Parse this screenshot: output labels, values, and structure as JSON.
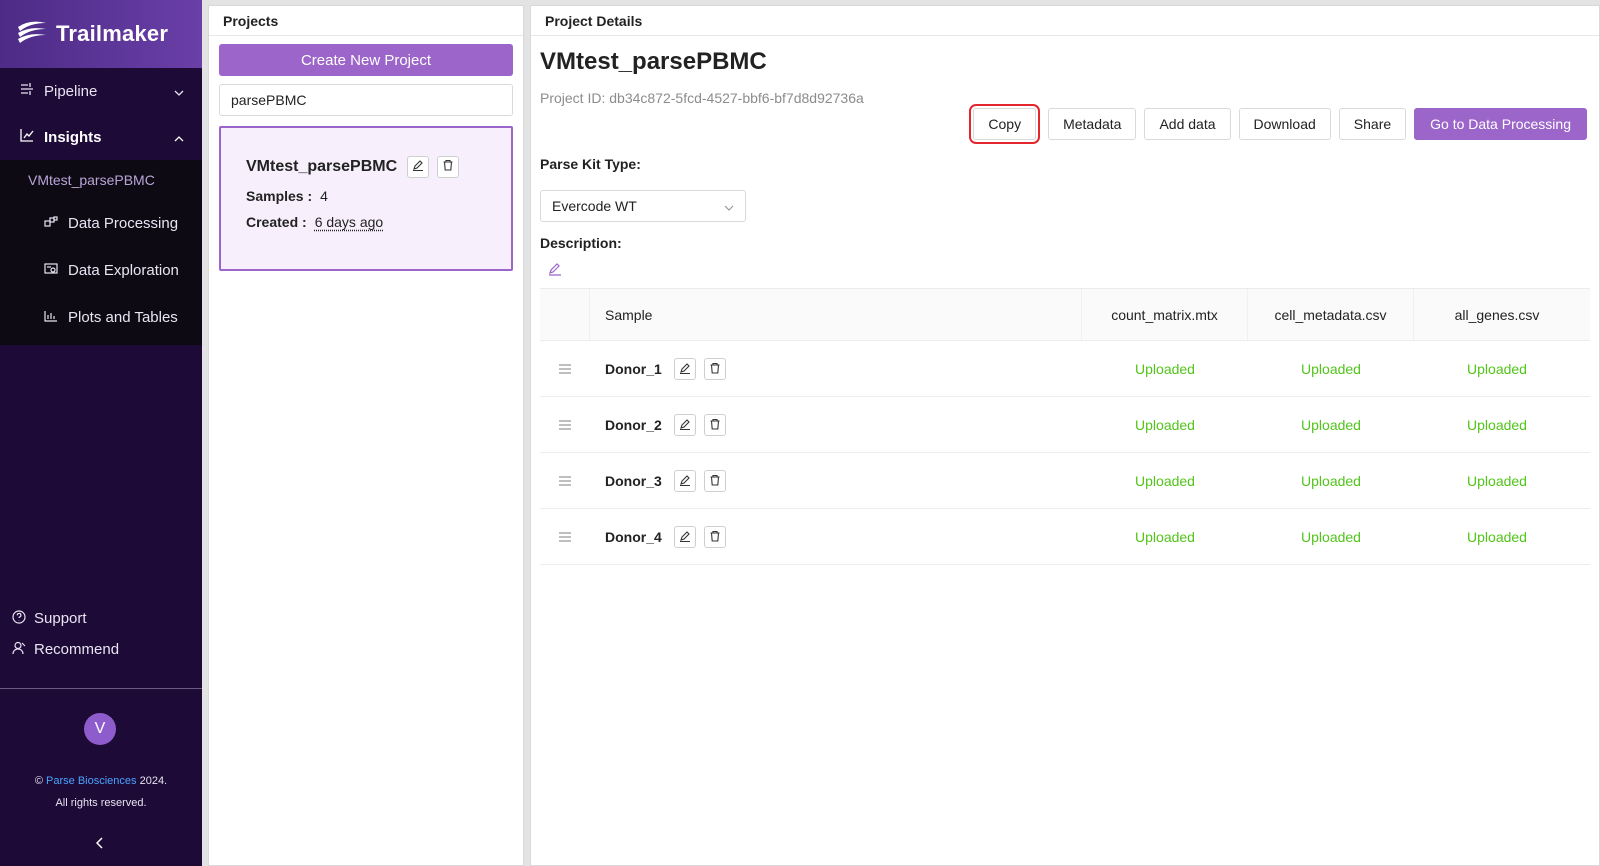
{
  "sidebar": {
    "brand": "Trailmaker",
    "nav": [
      {
        "label": "Pipeline"
      },
      {
        "label": "Insights"
      }
    ],
    "project_link": "VMtest_parsePBMC",
    "sub_items": [
      {
        "label": "Data Processing"
      },
      {
        "label": "Data Exploration"
      },
      {
        "label": "Plots and Tables"
      }
    ],
    "footer": [
      {
        "label": "Support"
      },
      {
        "label": "Recommend"
      }
    ],
    "avatar_initial": "V",
    "copyright_prefix": "© ",
    "copyright_link": "Parse Biosciences",
    "copyright_suffix": " 2024.",
    "copyright_line2": "All rights reserved."
  },
  "projects_panel": {
    "header": "Projects",
    "create_label": "Create New Project",
    "search_value": "parsePBMC",
    "card": {
      "title": "VMtest_parsePBMC",
      "samples_label": "Samples :",
      "samples_value": "4",
      "created_label": "Created :",
      "created_value": "6 days ago"
    }
  },
  "details_panel": {
    "header": "Project Details",
    "title": "VMtest_parsePBMC",
    "project_id": "Project ID: db34c872-5fcd-4527-bbf6-bf7d8d92736a",
    "buttons": {
      "copy": "Copy",
      "metadata": "Metadata",
      "add_data": "Add data",
      "download": "Download",
      "share": "Share",
      "process": "Go to Data Processing"
    },
    "kit_label": "Parse Kit Type:",
    "kit_value": "Evercode WT",
    "description_label": "Description:",
    "table": {
      "columns": [
        "Sample",
        "count_matrix.mtx",
        "cell_metadata.csv",
        "all_genes.csv"
      ],
      "rows": [
        {
          "sample": "Donor_1",
          "status": [
            "Uploaded",
            "Uploaded",
            "Uploaded"
          ]
        },
        {
          "sample": "Donor_2",
          "status": [
            "Uploaded",
            "Uploaded",
            "Uploaded"
          ]
        },
        {
          "sample": "Donor_3",
          "status": [
            "Uploaded",
            "Uploaded",
            "Uploaded"
          ]
        },
        {
          "sample": "Donor_4",
          "status": [
            "Uploaded",
            "Uploaded",
            "Uploaded"
          ]
        }
      ]
    }
  },
  "colors": {
    "accent": "#9b65c9",
    "sidebar_bg": "#1d0a36",
    "status_uploaded": "#52c41a",
    "highlight": "#e5262e"
  }
}
